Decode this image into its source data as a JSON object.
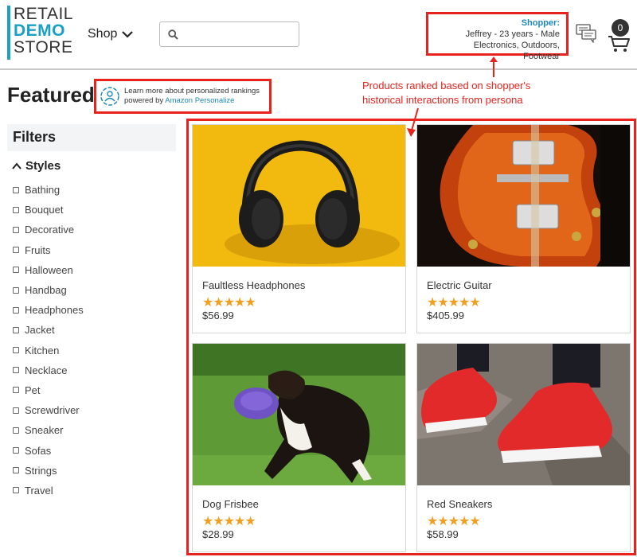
{
  "logo": {
    "line1": "RETAIL",
    "line2": "DEMO",
    "line3": "STORE"
  },
  "nav": {
    "shop_label": "Shop"
  },
  "search": {
    "placeholder": "",
    "value": ""
  },
  "shopper": {
    "label": "Shopper:",
    "summary": "Jeffrey - 23 years - Male",
    "interests": "Electronics, Outdoors, Footwear"
  },
  "cart": {
    "count": "0"
  },
  "page": {
    "title": "Featured"
  },
  "personalize": {
    "line1": "Learn more about personalized rankings",
    "line2_prefix": "powered by ",
    "link": "Amazon Personalize"
  },
  "annotation": {
    "text": "Products ranked based on shopper's historical interactions from persona"
  },
  "filters": {
    "title": "Filters",
    "group": "Styles",
    "items": [
      "Bathing",
      "Bouquet",
      "Decorative",
      "Fruits",
      "Halloween",
      "Handbag",
      "Headphones",
      "Jacket",
      "Kitchen",
      "Necklace",
      "Pet",
      "Screwdriver",
      "Sneaker",
      "Sofas",
      "Strings",
      "Travel"
    ]
  },
  "products": [
    {
      "name": "Faultless Headphones",
      "price": "$56.99",
      "stars": "★★★★★",
      "rating": 5
    },
    {
      "name": "Electric Guitar",
      "price": "$405.99",
      "stars": "★★★★★",
      "rating": 5
    },
    {
      "name": "Dog Frisbee",
      "price": "$28.99",
      "stars": "★★★★★",
      "rating": 5
    },
    {
      "name": "Red Sneakers",
      "price": "$58.99",
      "stars": "★★★★★",
      "rating": 5
    }
  ],
  "colors": {
    "accent": "#1aa0c8",
    "annotation": "#e8231d",
    "star": "#f0a020",
    "link": "#1e88b8"
  }
}
